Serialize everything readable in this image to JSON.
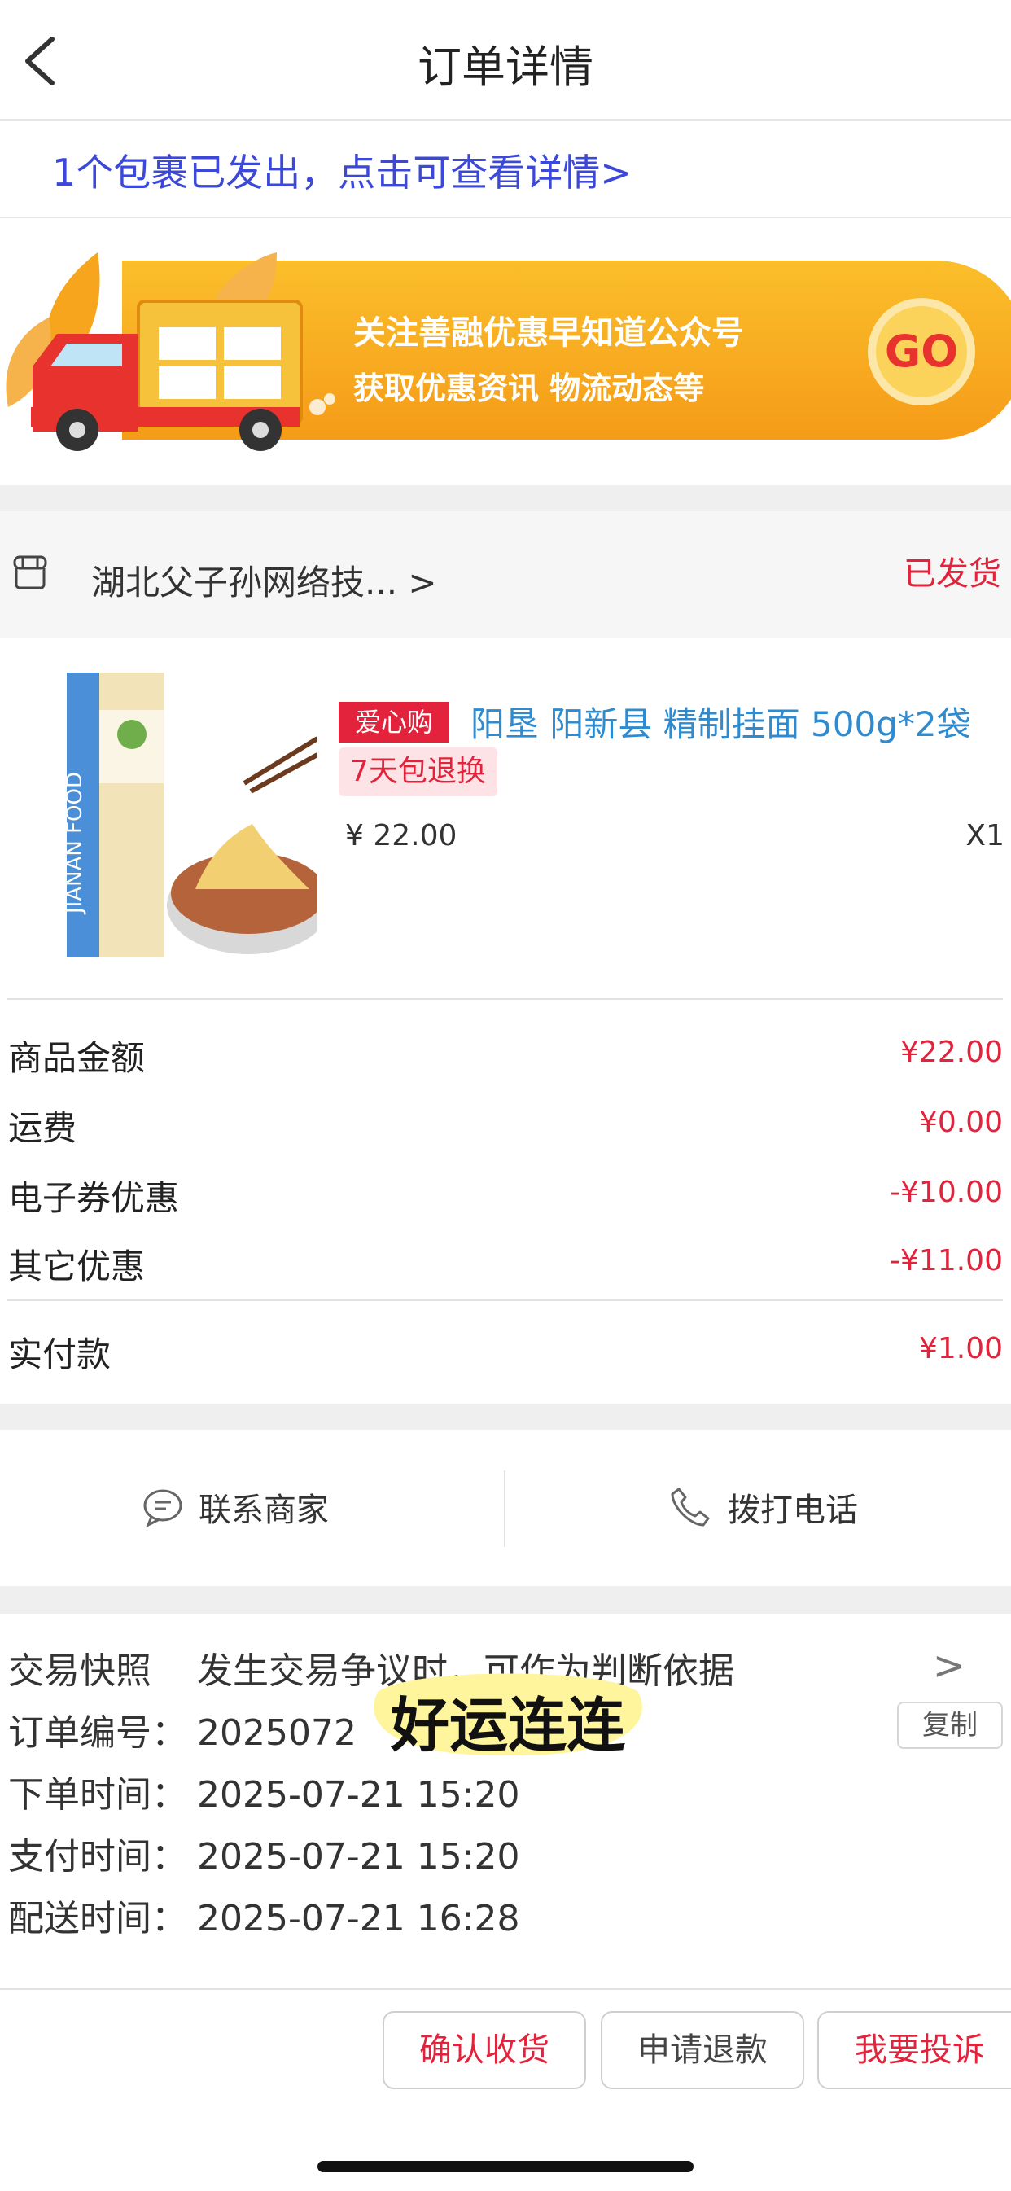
{
  "header": {
    "title": "订单详情"
  },
  "package_notice": "1个包裹已发出，点击可查看详情>",
  "banner": {
    "line1": "关注善融优惠早知道公众号",
    "line2": "获取优惠资讯 物流动态等",
    "button": "GO",
    "accent": "#f7a51c"
  },
  "shop": {
    "name": "湖北父子孙网络技... >",
    "status": "已发货"
  },
  "product": {
    "tag": "爱心购",
    "name": "阳垦 阳新县 精制挂面 500g*2袋",
    "return_tag": "7天包退换",
    "price": "¥ 22.00",
    "qty": "X1"
  },
  "amounts": {
    "goods_label": "商品金额",
    "goods_value": "¥22.00",
    "ship_label": "运费",
    "ship_value": "¥0.00",
    "coupon_label": "电子券优惠",
    "coupon_value": "-¥10.00",
    "other_label": "其它优惠",
    "other_value": "-¥11.00",
    "paid_label": "实付款",
    "paid_value": "¥1.00"
  },
  "actions": {
    "contact": "联系商家",
    "call": "拨打电话"
  },
  "info": {
    "snapshot_label": "交易快照",
    "snapshot_text": "发生交易争议时，可作为判断依据",
    "order_label": "订单编号：",
    "order_value": "2025072",
    "order_time_label": "下单时间：",
    "order_time": "2025-07-21 15:20",
    "pay_time_label": "支付时间：",
    "pay_time": "2025-07-21 15:20",
    "ship_time_label": "配送时间：",
    "ship_time": "2025-07-21 16:28",
    "copy": "复制",
    "sticker": "好运连连"
  },
  "footer": {
    "confirm": "确认收货",
    "refund": "申请退款",
    "complain": "我要投诉"
  },
  "colors": {
    "red": "#e2233b",
    "blue": "#3b48d8",
    "link": "#2e8bd0"
  }
}
